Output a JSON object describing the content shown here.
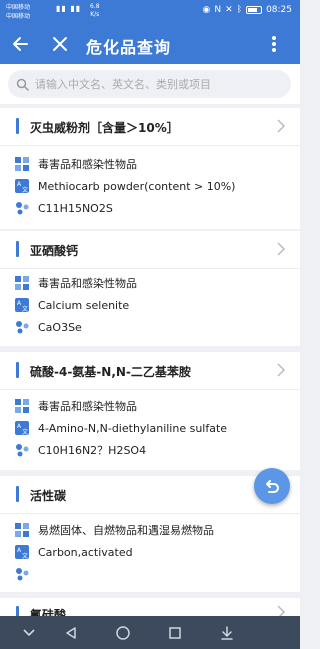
{
  "status_bar": {
    "carrier_1": "中国移动",
    "carrier_2": "中国移动",
    "speed": "6.8",
    "speed_unit": "K/s",
    "time": "08:25"
  },
  "app_bar": {
    "title": "危化品查询"
  },
  "search": {
    "placeholder": "请输入中文名、英文名、类别或项目"
  },
  "items": [
    {
      "name": "灭虫威粉剂［含量＞10%］",
      "category": "毒害品和感染性物品",
      "english": "Methiocarb powder(content > 10%)",
      "formula": "C11H15NO2S"
    },
    {
      "name": "亚硒酸钙",
      "category": "毒害品和感染性物品",
      "english": "Calcium selenite",
      "formula": "CaO3Se"
    },
    {
      "name": "硫酸-4-氨基-N,N-二乙基苯胺",
      "category": "毒害品和感染性物品",
      "english": "4-Amino-N,N-diethylaniline sulfate",
      "formula": "C10H16N2？H2SO4"
    },
    {
      "name": "活性碳",
      "category": "易燃固体、自燃物品和遇湿易燃物品",
      "english": "Carbon,activated",
      "formula": ""
    },
    {
      "name": "氰硅酸",
      "category": "",
      "english": "",
      "formula": ""
    }
  ],
  "colors": {
    "primary": "#3d7ad6",
    "fab": "#5b97e6",
    "navbar": "#3d4a5d"
  }
}
